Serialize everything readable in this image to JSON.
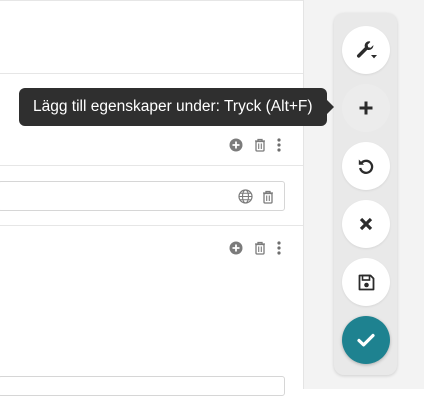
{
  "tooltip": {
    "text": "Lägg till egenskaper under: Tryck (Alt+F)"
  },
  "toolbar": {
    "buttons": [
      {
        "id": "tools",
        "icon": "wrench-dropdown-icon"
      },
      {
        "id": "add",
        "icon": "plus-icon"
      },
      {
        "id": "undo",
        "icon": "undo-icon"
      },
      {
        "id": "cancel",
        "icon": "close-icon"
      },
      {
        "id": "save",
        "icon": "floppy-disk-icon"
      },
      {
        "id": "confirm",
        "icon": "check-icon"
      }
    ],
    "primary_color": "#1e8290"
  },
  "rows": [
    {
      "actions": [
        "add-circle-icon",
        "trash-icon",
        "more-vertical-icon"
      ]
    },
    {
      "field_actions": [
        "globe-icon",
        "trash-icon"
      ]
    },
    {
      "actions": [
        "add-circle-icon",
        "trash-icon",
        "more-vertical-icon"
      ]
    }
  ]
}
